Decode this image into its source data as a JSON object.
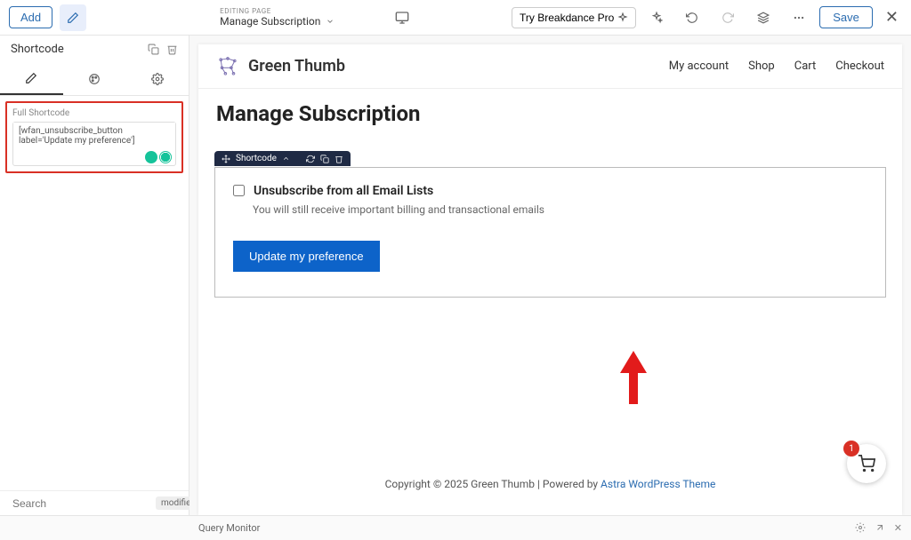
{
  "topbar": {
    "add_label": "Add",
    "editing_label": "EDITING PAGE",
    "page_name": "Manage Subscription",
    "pro_label": "Try Breakdance Pro",
    "save_label": "Save"
  },
  "sidebar": {
    "panel_title": "Shortcode",
    "field_label": "Full Shortcode",
    "shortcode_value": "[wfan_unsubscribe_button label='Update my preference']",
    "search_placeholder": "Search",
    "modified_chip": "modified"
  },
  "preview": {
    "site_name": "Green Thumb",
    "nav": {
      "account": "My account",
      "shop": "Shop",
      "cart": "Cart",
      "checkout": "Checkout"
    },
    "page_title": "Manage Subscription",
    "element_toolbar_label": "Shortcode",
    "unsub_title": "Unsubscribe from all Email Lists",
    "unsub_note": "You will still receive important billing and transactional emails",
    "update_btn": "Update my preference",
    "footer_prefix": "Copyright © 2025 Green Thumb | Powered by ",
    "footer_link": "Astra WordPress Theme",
    "cart_count": "1"
  },
  "statusbar": {
    "qm": "Query Monitor"
  }
}
